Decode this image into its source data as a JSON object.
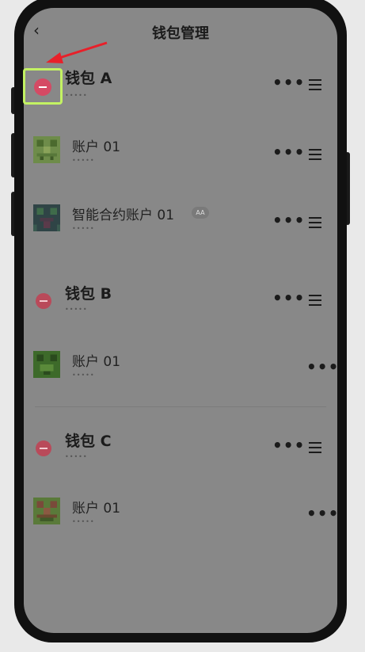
{
  "header": {
    "back_icon": "‹",
    "title": "钱包管理"
  },
  "masked_text": "•••••",
  "wallets": [
    {
      "name": "钱包 A",
      "accounts": [
        {
          "name": "账户 01",
          "badge": ""
        },
        {
          "name": "智能合约账户 01",
          "badge": "AA"
        }
      ]
    },
    {
      "name": "钱包 B",
      "accounts": [
        {
          "name": "账户 01",
          "badge": ""
        }
      ]
    },
    {
      "name": "钱包 C",
      "accounts": [
        {
          "name": "账户 01",
          "badge": ""
        }
      ]
    }
  ],
  "icons": {
    "more": "•••",
    "delete": "minus-circle-icon",
    "drag": "drag-handle-icon"
  },
  "colors": {
    "screen_bg": "#888888",
    "delete_red": "#d54a64",
    "highlight": "#c3f263",
    "arrow": "#e8202a"
  }
}
